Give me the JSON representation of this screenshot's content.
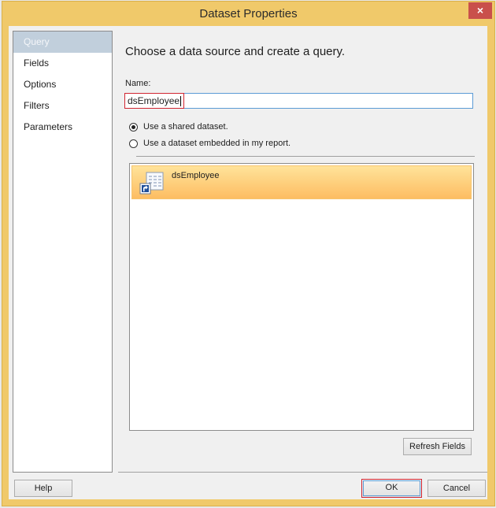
{
  "window": {
    "title": "Dataset Properties",
    "close_label": "×"
  },
  "nav": {
    "items": [
      {
        "label": "Query",
        "selected": true
      },
      {
        "label": "Fields",
        "selected": false
      },
      {
        "label": "Options",
        "selected": false
      },
      {
        "label": "Filters",
        "selected": false
      },
      {
        "label": "Parameters",
        "selected": false
      }
    ]
  },
  "query": {
    "heading": "Choose a data source and create a query.",
    "name_label": "Name:",
    "name_value": "dsEmployee",
    "radio_shared_label": "Use a shared dataset.",
    "radio_shared_checked": true,
    "radio_embedded_label": "Use a dataset embedded in my report.",
    "radio_embedded_checked": false,
    "datasets": [
      {
        "name": "dsEmployee",
        "icon": "shared-dataset-shortcut-icon",
        "selected": true
      }
    ],
    "refresh_fields_label": "Refresh Fields"
  },
  "footer": {
    "help_label": "Help",
    "ok_label": "OK",
    "cancel_label": "Cancel"
  }
}
